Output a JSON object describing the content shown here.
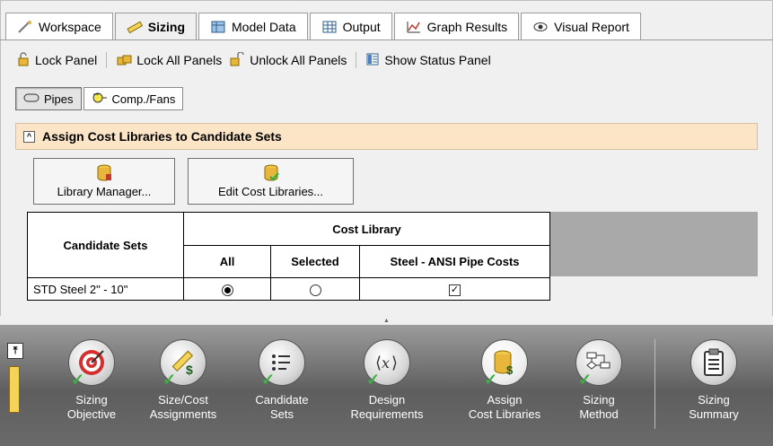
{
  "tabs": [
    {
      "label": "Workspace",
      "icon": "workspace-icon"
    },
    {
      "label": "Sizing",
      "icon": "ruler-pencil-icon",
      "active": true
    },
    {
      "label": "Model Data",
      "icon": "model-data-icon"
    },
    {
      "label": "Output",
      "icon": "output-table-icon"
    },
    {
      "label": "Graph Results",
      "icon": "graph-icon"
    },
    {
      "label": "Visual Report",
      "icon": "eye-icon"
    }
  ],
  "toolbar": {
    "lock_panel": "Lock Panel",
    "lock_all": "Lock All Panels",
    "unlock_all": "Unlock All Panels",
    "show_status": "Show Status Panel"
  },
  "subtabs": [
    {
      "label": "Pipes",
      "active": true
    },
    {
      "label": "Comp./Fans"
    }
  ],
  "section": {
    "title": "Assign Cost Libraries to Candidate Sets",
    "library_manager": "Library Manager...",
    "edit_cost_libraries": "Edit Cost Libraries..."
  },
  "table": {
    "candidate_header": "Candidate Sets",
    "cost_library_header": "Cost Library",
    "columns": [
      "All",
      "Selected",
      "Steel - ANSI Pipe Costs"
    ],
    "rows": [
      {
        "name": "STD Steel 2\" - 10\"",
        "all": true,
        "selected": false,
        "steel_ansi": true
      }
    ]
  },
  "wizard": {
    "items": [
      {
        "line1": "Sizing",
        "line2": "Objective",
        "icon": "target-icon",
        "done": true
      },
      {
        "line1": "Size/Cost",
        "line2": "Assignments",
        "icon": "ruler-dollar-icon",
        "done": true
      },
      {
        "line1": "Candidate",
        "line2": "Sets",
        "icon": "list-icon",
        "done": true
      },
      {
        "line1": "Design",
        "line2": "Requirements",
        "icon": "function-x-icon",
        "done": true
      },
      {
        "line1": "Assign",
        "line2": "Cost Libraries",
        "icon": "database-dollar-icon",
        "done": true
      },
      {
        "line1": "Sizing",
        "line2": "Method",
        "icon": "flowchart-icon",
        "done": true
      },
      {
        "line1": "Sizing",
        "line2": "Summary",
        "icon": "clipboard-icon",
        "done": false
      }
    ]
  },
  "colors": {
    "section_header_bg": "#fce4c6",
    "wizard_bar": "#6a6a6a",
    "check_green": "#3cb043"
  }
}
